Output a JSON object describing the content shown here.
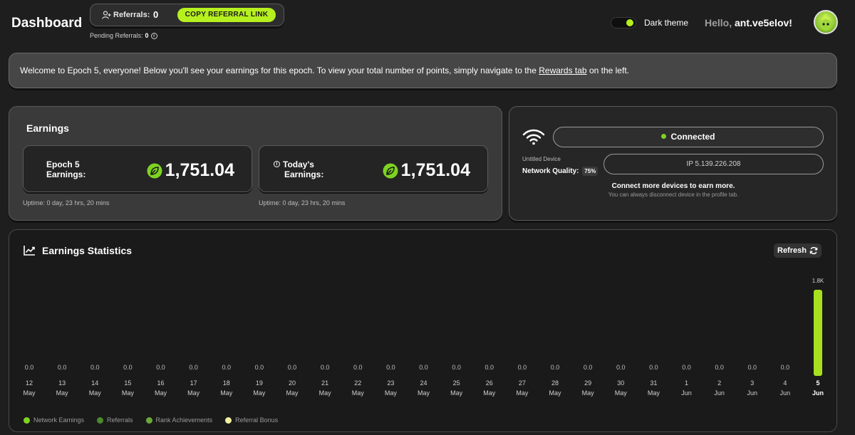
{
  "header": {
    "title": "Dashboard",
    "referrals_label": "Referrals:",
    "referrals_count": "0",
    "copy_button": "COPY REFERRAL LINK",
    "pending_label": "Pending Referrals:",
    "pending_count": "0",
    "theme_label": "Dark theme",
    "hello_prefix": "Hello,",
    "username": "ant.ve5elov!"
  },
  "banner": {
    "text_before": "Welcome to Epoch 5, everyone! Below you'll see your earnings for this epoch. To view your total number of points, simply navigate to the ",
    "link": "Rewards tab",
    "text_after": " on the left."
  },
  "earnings": {
    "title": "Earnings",
    "epoch_label_1": "Epoch 5",
    "epoch_label_2": "Earnings:",
    "epoch_value": "1,751.04",
    "today_label_1": "Today's",
    "today_label_2": "Earnings:",
    "today_value": "1,751.04",
    "uptime_1": "Uptime: 0 day, 23 hrs, 20 mins",
    "uptime_2": "Uptime: 0 day, 23 hrs, 20 mins"
  },
  "device": {
    "status": "Connected",
    "name": "Untitled Device",
    "quality_label": "Network Quality:",
    "quality_value": "75%",
    "ip": "IP 5.139.226.208",
    "connect_more": "Connect more devices to earn more.",
    "disconnect_note": "You can always disconnect device in the profile tab."
  },
  "stats": {
    "title": "Earnings Statistics",
    "refresh": "Refresh"
  },
  "chart_data": {
    "type": "bar",
    "categories": [
      [
        "12",
        "May"
      ],
      [
        "13",
        "May"
      ],
      [
        "14",
        "May"
      ],
      [
        "15",
        "May"
      ],
      [
        "16",
        "May"
      ],
      [
        "17",
        "May"
      ],
      [
        "18",
        "May"
      ],
      [
        "19",
        "May"
      ],
      [
        "20",
        "May"
      ],
      [
        "21",
        "May"
      ],
      [
        "22",
        "May"
      ],
      [
        "23",
        "May"
      ],
      [
        "24",
        "May"
      ],
      [
        "25",
        "May"
      ],
      [
        "26",
        "May"
      ],
      [
        "27",
        "May"
      ],
      [
        "28",
        "May"
      ],
      [
        "29",
        "May"
      ],
      [
        "30",
        "May"
      ],
      [
        "31",
        "May"
      ],
      [
        "1",
        "Jun"
      ],
      [
        "2",
        "Jun"
      ],
      [
        "3",
        "Jun"
      ],
      [
        "4",
        "Jun"
      ],
      [
        "5",
        "Jun"
      ]
    ],
    "value_labels": [
      "0.0",
      "0.0",
      "0.0",
      "0.0",
      "0.0",
      "0.0",
      "0.0",
      "0.0",
      "0.0",
      "0.0",
      "0.0",
      "0.0",
      "0.0",
      "0.0",
      "0.0",
      "0.0",
      "0.0",
      "0.0",
      "0.0",
      "0.0",
      "0.0",
      "0.0",
      "0.0",
      "0.0",
      "1.8K"
    ],
    "values": [
      0,
      0,
      0,
      0,
      0,
      0,
      0,
      0,
      0,
      0,
      0,
      0,
      0,
      0,
      0,
      0,
      0,
      0,
      0,
      0,
      0,
      0,
      0,
      0,
      1751.04
    ],
    "ymax": 1751.04,
    "bar_color": "#a6e01e",
    "legend": [
      {
        "name": "Network Earnings",
        "color": "#7ed321"
      },
      {
        "name": "Referrals",
        "color": "#4a8a2a"
      },
      {
        "name": "Rank Achievements",
        "color": "#6aa83a"
      },
      {
        "name": "Referral Bonus",
        "color": "#f0f0a0"
      }
    ]
  }
}
